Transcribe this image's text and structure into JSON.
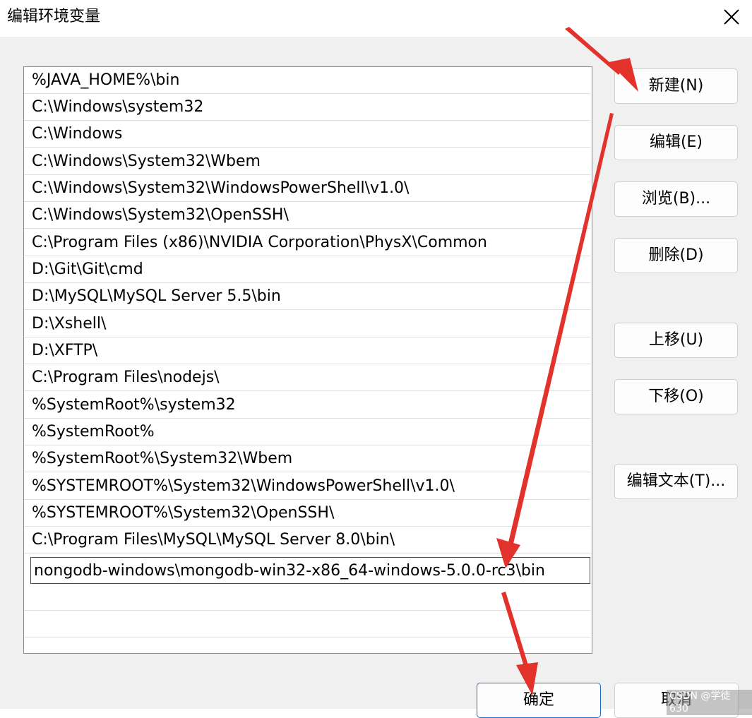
{
  "window": {
    "title": "编辑环境变量",
    "close_icon": "close-icon"
  },
  "path_list": {
    "items": [
      "%JAVA_HOME%\\bin",
      "C:\\Windows\\system32",
      "C:\\Windows",
      "C:\\Windows\\System32\\Wbem",
      "C:\\Windows\\System32\\WindowsPowerShell\\v1.0\\",
      "C:\\Windows\\System32\\OpenSSH\\",
      "C:\\Program Files (x86)\\NVIDIA Corporation\\PhysX\\Common",
      "D:\\Git\\Git\\cmd",
      "D:\\MySQL\\MySQL Server 5.5\\bin",
      "D:\\Xshell\\",
      "D:\\XFTP\\",
      "C:\\Program Files\\nodejs\\",
      "%SystemRoot%\\system32",
      "%SystemRoot%",
      "%SystemRoot%\\System32\\Wbem",
      "%SYSTEMROOT%\\System32\\WindowsPowerShell\\v1.0\\",
      "%SYSTEMROOT%\\System32\\OpenSSH\\",
      "C:\\Program Files\\MySQL\\MySQL Server 8.0\\bin\\"
    ],
    "editing_value": "nongodb-windows\\mongodb-win32-x86_64-windows-5.0.0-rc3\\bin"
  },
  "buttons": {
    "new": "新建(N)",
    "edit": "编辑(E)",
    "browse": "浏览(B)...",
    "delete": "删除(D)",
    "move_up": "上移(U)",
    "move_down": "下移(O)",
    "edit_text": "编辑文本(T)...",
    "ok": "确定",
    "cancel": "取消"
  },
  "watermark": "CSDN @学徒630",
  "colors": {
    "annotation_arrow": "#e2322b",
    "ok_border": "#1e6fc6"
  }
}
